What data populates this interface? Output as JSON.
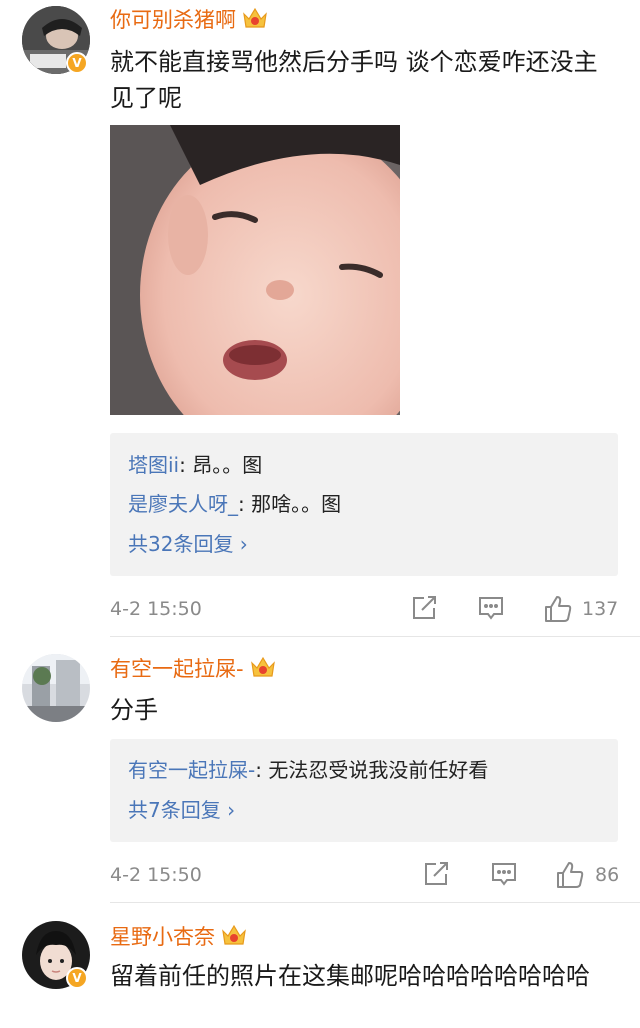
{
  "comments": [
    {
      "username": "你可别杀猪啊",
      "text": "就不能直接骂他然后分手吗 谈个恋爱咋还没主见了呢",
      "replies": [
        {
          "user": "塔图ii",
          "text": ": 昂。。图"
        },
        {
          "user": "是廖夫人呀_",
          "text": ": 那啥。。图"
        }
      ],
      "reply_count": "共32条回复 ›",
      "time": "4-2 15:50",
      "likes": "137",
      "verified_badge": "V"
    },
    {
      "username": "有空一起拉屎-",
      "text": "分手",
      "replies": [
        {
          "user": "有空一起拉屎-",
          "text": ": 无法忍受说我没前任好看"
        }
      ],
      "reply_count": "共7条回复 ›",
      "time": "4-2 15:50",
      "likes": "86"
    },
    {
      "username": "星野小杏奈",
      "text": "留着前任的照片在这集邮呢哈哈哈哈哈哈哈哈",
      "verified_badge": "V"
    }
  ],
  "colors": {
    "username": "#e86a12",
    "reply_user": "#4a76b8",
    "meta": "#8a8a8a",
    "reply_bg": "#f2f2f2"
  }
}
